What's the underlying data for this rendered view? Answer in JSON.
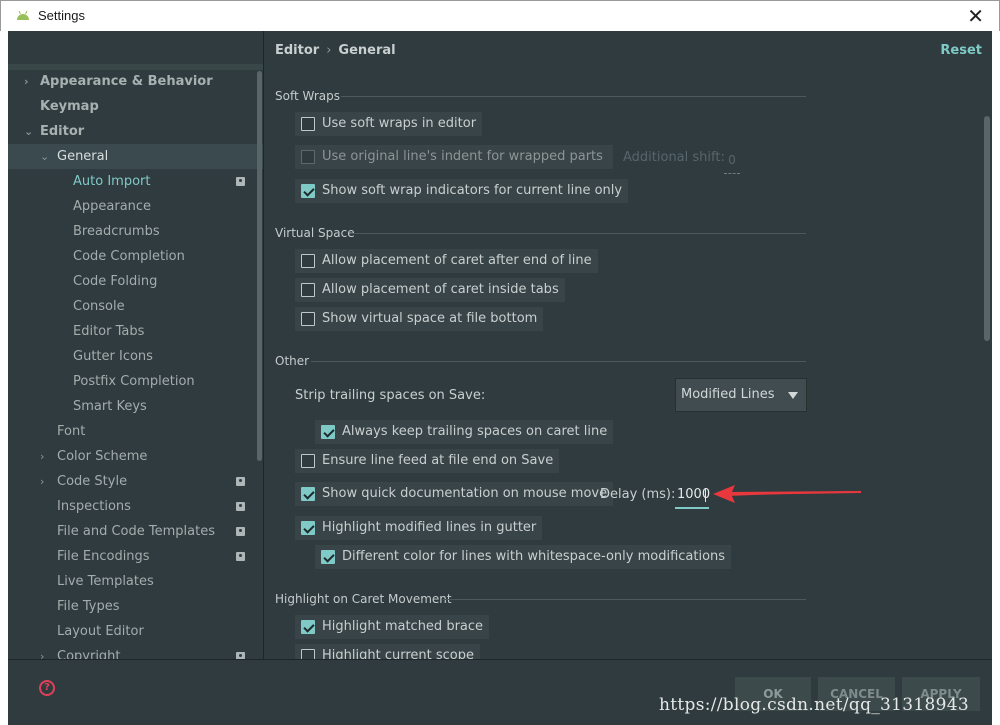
{
  "window": {
    "title": "Settings",
    "close_glyph": "✕"
  },
  "sidebar": {
    "items": [
      {
        "label": "Appearance & Behavior",
        "level": 0,
        "arrow": "›",
        "bold": true
      },
      {
        "label": "Keymap",
        "level": 0,
        "arrow": "",
        "bold": true
      },
      {
        "label": "Editor",
        "level": 0,
        "arrow": "⌄",
        "bold": true
      },
      {
        "label": "General",
        "level": 1,
        "arrow": "⌄",
        "selected": true
      },
      {
        "label": "Auto Import",
        "level": 2,
        "accent": true,
        "badge": true
      },
      {
        "label": "Appearance",
        "level": 2
      },
      {
        "label": "Breadcrumbs",
        "level": 2
      },
      {
        "label": "Code Completion",
        "level": 2
      },
      {
        "label": "Code Folding",
        "level": 2
      },
      {
        "label": "Console",
        "level": 2
      },
      {
        "label": "Editor Tabs",
        "level": 2
      },
      {
        "label": "Gutter Icons",
        "level": 2
      },
      {
        "label": "Postfix Completion",
        "level": 2
      },
      {
        "label": "Smart Keys",
        "level": 2
      },
      {
        "label": "Font",
        "level": 1
      },
      {
        "label": "Color Scheme",
        "level": 1,
        "arrow": "›"
      },
      {
        "label": "Code Style",
        "level": 1,
        "arrow": "›",
        "badge": true
      },
      {
        "label": "Inspections",
        "level": 1,
        "badge": true
      },
      {
        "label": "File and Code Templates",
        "level": 1,
        "badge": true
      },
      {
        "label": "File Encodings",
        "level": 1,
        "badge": true
      },
      {
        "label": "Live Templates",
        "level": 1
      },
      {
        "label": "File Types",
        "level": 1
      },
      {
        "label": "Layout Editor",
        "level": 1
      },
      {
        "label": "Copyright",
        "level": 1,
        "arrow": "›",
        "badge": true
      }
    ]
  },
  "main": {
    "breadcrumb": {
      "first": "Editor",
      "separator": "›",
      "second": "General"
    },
    "reset": "Reset",
    "sections": {
      "soft_wraps": "Soft Wraps",
      "virtual_space": "Virtual Space",
      "other": "Other",
      "highlight_caret": "Highlight on Caret Movement"
    },
    "options": {
      "use_soft_wraps": "Use soft wraps in editor",
      "use_original_indent": "Use original line's indent for wrapped parts",
      "show_soft_wrap_indicators": "Show soft wrap indicators for current line only",
      "caret_after_end": "Allow placement of caret after end of line",
      "caret_inside_tabs": "Allow placement of caret inside tabs",
      "virtual_space_bottom": "Show virtual space at file bottom",
      "keep_trailing_spaces": "Always keep trailing spaces on caret line",
      "ensure_line_feed": "Ensure line feed at file end on Save",
      "quick_doc": "Show quick documentation on mouse move",
      "highlight_modified": "Highlight modified lines in gutter",
      "different_color": "Different color for lines with whitespace-only modifications",
      "highlight_brace": "Highlight matched brace",
      "highlight_scope": "Highlight current scope"
    },
    "additional_shift_label": "Additional shift:",
    "additional_shift_value": "0",
    "strip_label": "Strip trailing spaces on Save:",
    "strip_value": "Modified Lines",
    "delay_label": "Delay (ms):",
    "delay_value": "1000"
  },
  "footer": {
    "help": "?",
    "ok": "OK",
    "cancel": "CANCEL",
    "apply": "APPLY"
  },
  "watermark": "https://blog.csdn.net/qq_31318943",
  "colors": {
    "accent": "#7fc9c6",
    "background": "#2f3b3e",
    "annotation_arrow": "#e8383d"
  }
}
